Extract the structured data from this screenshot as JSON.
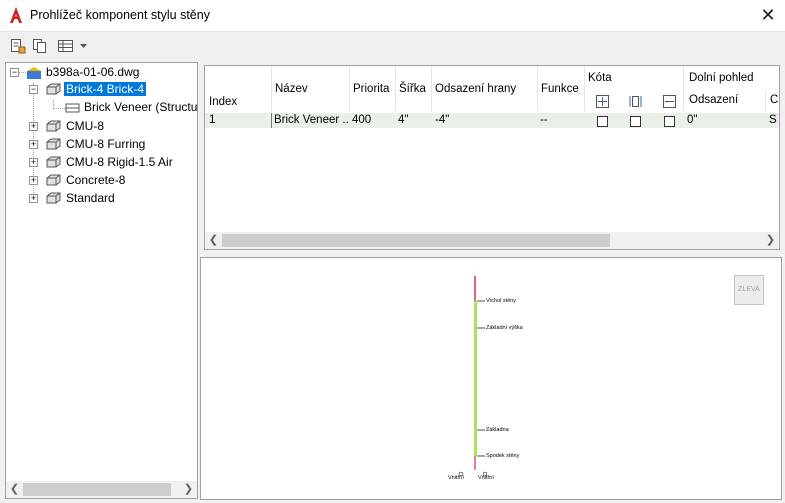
{
  "window": {
    "title": "Prohlížeč komponent stylu stěny",
    "close_glyph": "✕"
  },
  "toolbar": {
    "icons": [
      "properties-icon",
      "copy-icon",
      "table-view-icon",
      "dropdown-arrow-icon"
    ]
  },
  "tree": {
    "root_label": "b398a-01-06.dwg",
    "items": [
      {
        "label": "Brick-4 Brick-4",
        "selected": true,
        "expanded": true
      },
      {
        "label": "Brick Veneer (Structu",
        "child": true
      },
      {
        "label": "CMU-8"
      },
      {
        "label": "CMU-8 Furring"
      },
      {
        "label": "CMU-8 Rigid-1.5 Air"
      },
      {
        "label": "Concrete-8"
      },
      {
        "label": "Standard"
      }
    ]
  },
  "grid": {
    "headers": {
      "index": "Index",
      "name": "Název",
      "priority": "Priorita",
      "width": "Šířka",
      "edge_offset": "Odsazení hrany",
      "function": "Funkce",
      "dimension": "Kóta",
      "bottom_view": "Dolní pohled",
      "offset": "Odsazení",
      "next_col": "C"
    },
    "dimension_icons": [
      "dim-center-icon",
      "dim-sides-icon",
      "dim-minus-icon"
    ],
    "rows": [
      {
        "index": "1",
        "name": "Brick Veneer ...",
        "priority": "400",
        "width": "4\"",
        "edge_offset": "-4\"",
        "function": "--",
        "offset": "0\"",
        "next_col": "S"
      }
    ]
  },
  "preview": {
    "view_button": "ZLEVA",
    "labels": {
      "wall_top": "Vrchol stěny",
      "base_height": "Základní výška",
      "base": "Základna",
      "wall_bottom": "Spodek stěny",
      "left_bottom": "Vnitřní",
      "right_bottom": "Vnitřní"
    },
    "colors": {
      "line": "#b3e05a",
      "top": "#d0021b"
    }
  }
}
